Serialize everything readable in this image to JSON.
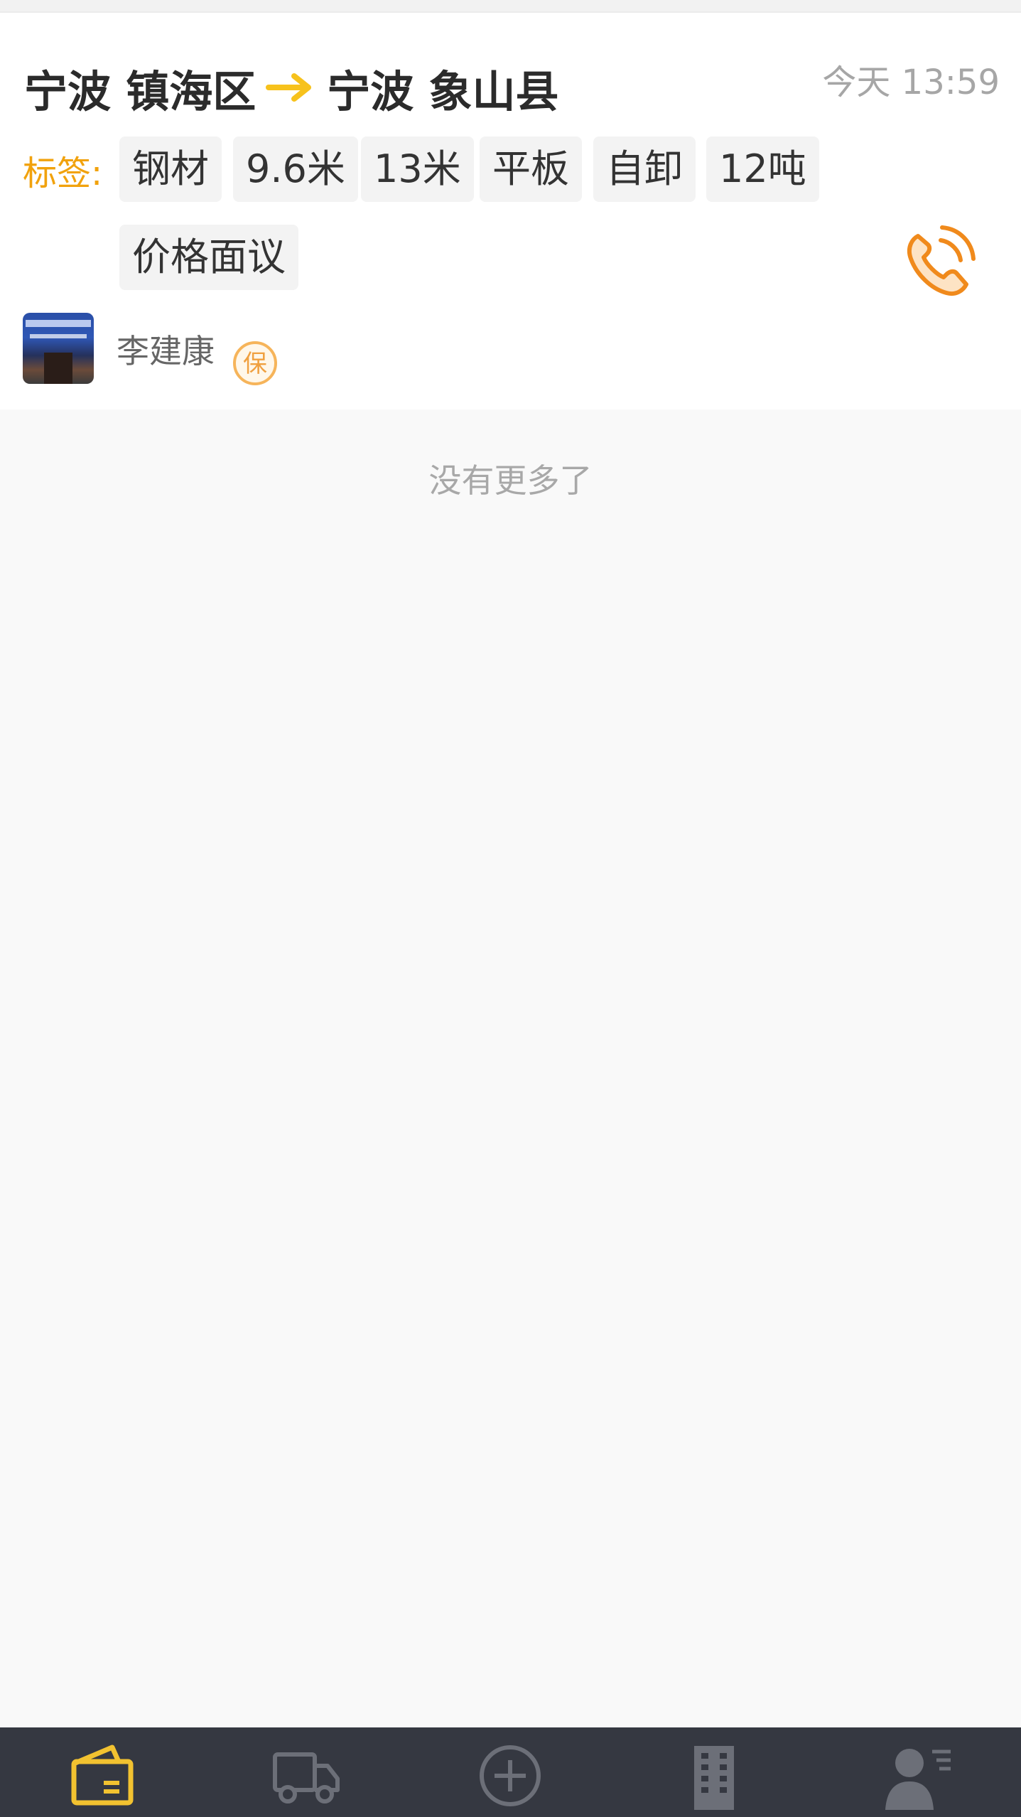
{
  "listing": {
    "origin": "宁波 镇海区",
    "destination": "宁波 象山县",
    "time": "今天 13:59",
    "tags_label": "标签:",
    "tags": [
      "钢材",
      "9.6米",
      "13米",
      "平板",
      "自卸",
      "12吨",
      "价格面议"
    ],
    "user_name": "李建康",
    "badge_text": "保"
  },
  "footer_note": "没有更多了",
  "tabbar": {
    "tabs": [
      {
        "icon": "wallet-icon",
        "active": true
      },
      {
        "icon": "truck-icon",
        "active": false
      },
      {
        "icon": "plus-circle-icon",
        "active": false
      },
      {
        "icon": "building-icon",
        "active": false
      },
      {
        "icon": "user-profile-icon",
        "active": false
      }
    ]
  },
  "colors": {
    "accent": "#f1a20d",
    "active_tab": "#f2c230",
    "inactive_tab": "#6c6f78",
    "tabbar_bg": "#353841"
  }
}
